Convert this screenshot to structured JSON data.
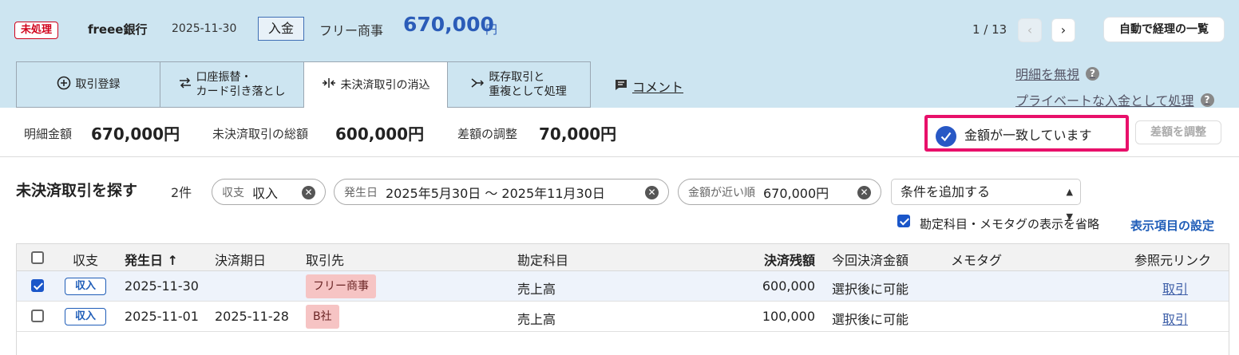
{
  "header": {
    "status_badge": "未処理",
    "bank_name": "freee銀行",
    "date": "2025-11-30",
    "direction": "入金",
    "partner": "フリー商事",
    "amount": "670,000",
    "currency": "円",
    "pager": "1 / 13",
    "prev_icon": "‹",
    "next_icon": "›",
    "auto_list_button": "自動で経理の一覧"
  },
  "tabs": [
    {
      "icon": "plus-circle-icon",
      "label": "取引登録"
    },
    {
      "icon": "transfer-arrows-icon",
      "label_line1": "口座振替・",
      "label_line2": "カード引き落とし"
    },
    {
      "icon": "merge-icon",
      "label": "未決済取引の消込"
    },
    {
      "icon": "duplicate-icon",
      "label_line1": "既存取引と",
      "label_line2": "重複として処理"
    }
  ],
  "comment_link": "コメント",
  "side_links": {
    "ignore": "明細を無視",
    "private": "プライベートな入金として処理",
    "help": "?"
  },
  "summary": {
    "detail_label": "明細金額",
    "detail_value": "670,000円",
    "unsettled_label": "未決済取引の総額",
    "unsettled_value": "600,000円",
    "diff_label": "差額の調整",
    "diff_value": "70,000円",
    "match_message": "金額が一致しています",
    "adjust_button": "差額を調整"
  },
  "search": {
    "title": "未決済取引を探す",
    "count": "2件",
    "chips": [
      {
        "label": "収支",
        "value": "収入"
      },
      {
        "label": "発生日",
        "value": "2025年5月30日 〜 2025年11月30日"
      },
      {
        "label": "金額が近い順",
        "value": "670,000円"
      }
    ],
    "add_condition": "条件を追加する",
    "omit_label": "勘定科目・メモタグの表示を省略",
    "omit_checked": true,
    "display_settings": "表示項目の設定"
  },
  "table": {
    "headers": {
      "type": "収支",
      "date": "発生日",
      "sort_icon": "↑",
      "due": "決済期日",
      "partner": "取引先",
      "account": "勘定科目",
      "balance": "決済残額",
      "this_amount": "今回決済金額",
      "memo": "メモタグ",
      "ref": "参照元リンク"
    },
    "rows": [
      {
        "checked": true,
        "type": "収入",
        "date": "2025-11-30",
        "due": "",
        "partner": "フリー商事",
        "account": "売上高",
        "balance": "600,000",
        "this_amount": "選択後に可能",
        "memo": "",
        "ref": "取引"
      },
      {
        "checked": false,
        "type": "収入",
        "date": "2025-11-01",
        "due": "2025-11-28",
        "partner": "B社",
        "account": "売上高",
        "balance": "100,000",
        "this_amount": "選択後に可能",
        "memo": "",
        "ref": "取引"
      }
    ]
  },
  "colors": {
    "accent_blue": "#2b5cb8",
    "highlight_border": "#e8106a",
    "status_red": "#d0021b"
  }
}
